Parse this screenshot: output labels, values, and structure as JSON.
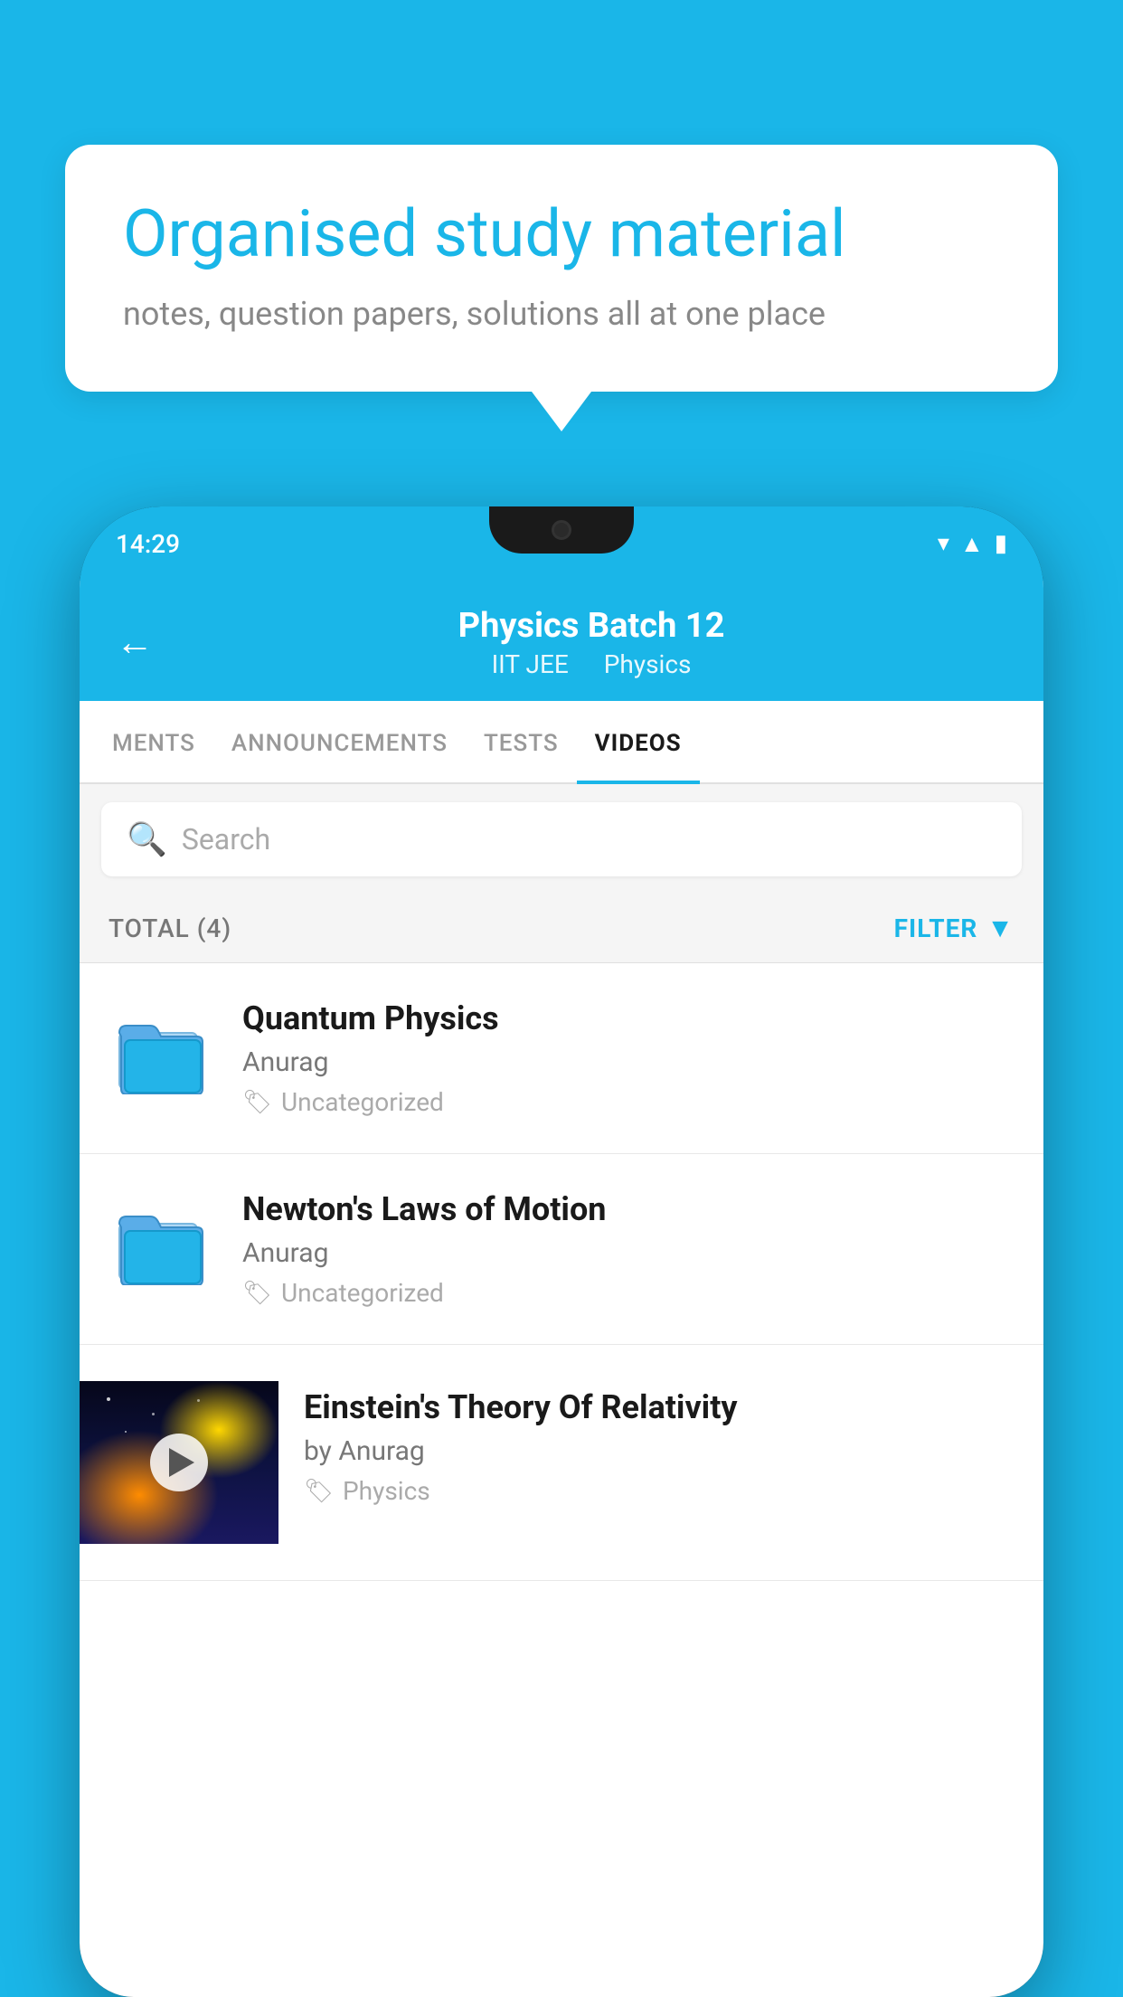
{
  "background_color": "#1ab6e8",
  "speech_bubble": {
    "title": "Organised study material",
    "subtitle": "notes, question papers, solutions all at one place"
  },
  "phone": {
    "status_bar": {
      "time": "14:29"
    },
    "header": {
      "title": "Physics Batch 12",
      "subtitle_part1": "IIT JEE",
      "subtitle_part2": "Physics",
      "back_label": "←"
    },
    "tabs": [
      {
        "label": "MENTS",
        "active": false
      },
      {
        "label": "ANNOUNCEMENTS",
        "active": false
      },
      {
        "label": "TESTS",
        "active": false
      },
      {
        "label": "VIDEOS",
        "active": true
      }
    ],
    "search": {
      "placeholder": "Search"
    },
    "filter_row": {
      "total_label": "TOTAL (4)",
      "filter_label": "FILTER"
    },
    "videos": [
      {
        "title": "Quantum Physics",
        "author": "Anurag",
        "tag": "Uncategorized",
        "type": "folder"
      },
      {
        "title": "Newton's Laws of Motion",
        "author": "Anurag",
        "tag": "Uncategorized",
        "type": "folder"
      },
      {
        "title": "Einstein's Theory Of Relativity",
        "author": "by Anurag",
        "tag": "Physics",
        "type": "video"
      }
    ]
  }
}
